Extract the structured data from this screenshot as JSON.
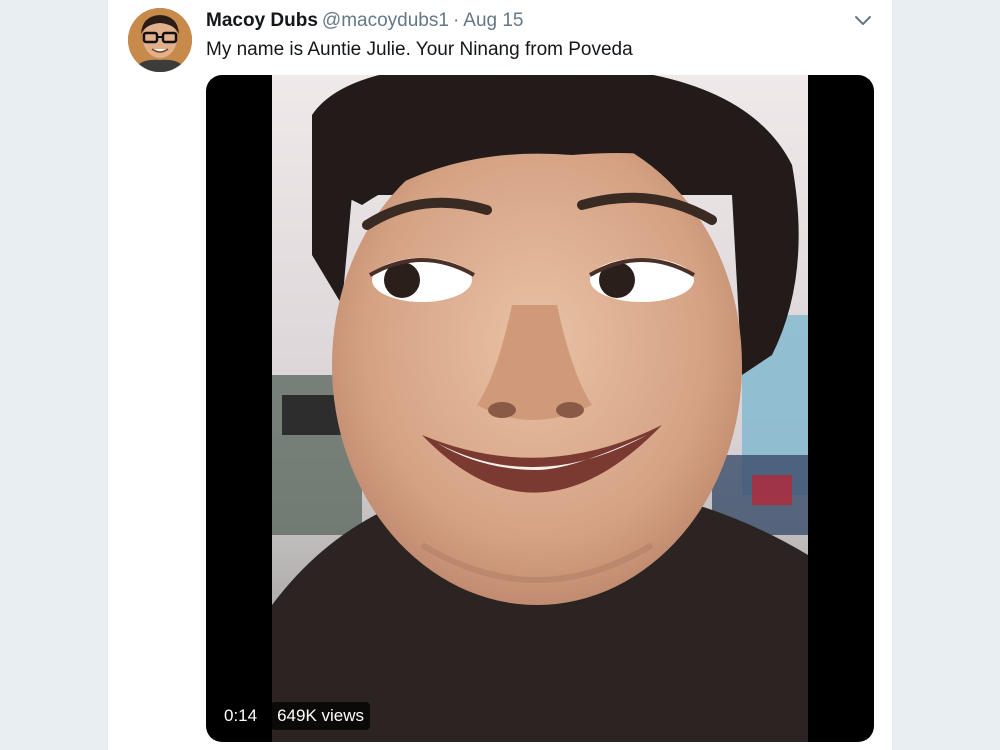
{
  "tweet": {
    "display_name": "Macoy Dubs",
    "handle": "@macoydubs1",
    "separator": "·",
    "date": "Aug 15",
    "text": "My name is Auntie Julie. Your Ninang from Poveda",
    "menu_icon": "chevron-down-icon"
  },
  "media": {
    "type": "video",
    "duration": "0:14",
    "views": "649K views"
  },
  "colors": {
    "page_background": "#e9eef3",
    "card_background": "#ffffff",
    "name_color": "#14171a",
    "meta_color": "#657786"
  }
}
